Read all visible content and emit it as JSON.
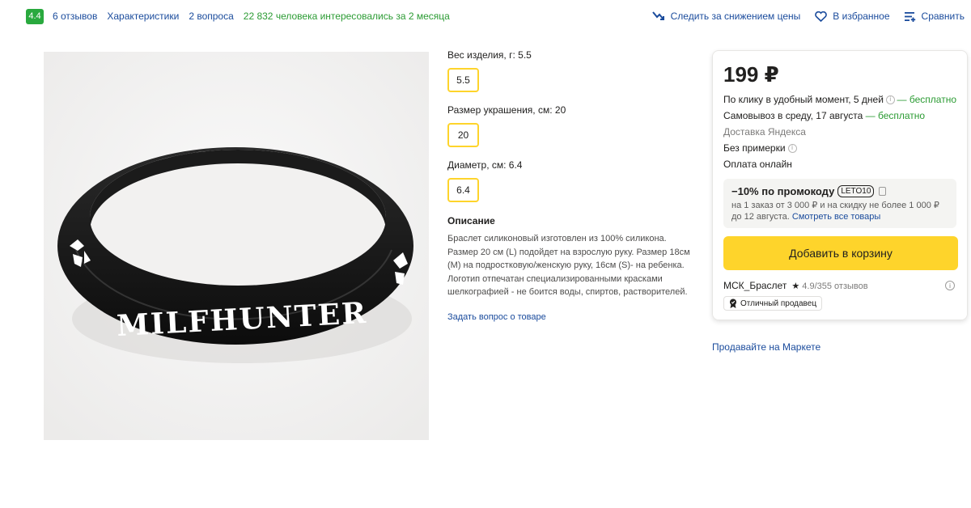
{
  "top_bar": {
    "rating": "4.4",
    "reviews_link": "6 отзывов",
    "specs_link": "Характеристики",
    "questions_link": "2 вопроса",
    "interest_text": "22 832 человека интересовались за 2 месяца",
    "actions": {
      "price_watch": "Следить за снижением цены",
      "favorite": "В избранное",
      "compare": "Сравнить"
    }
  },
  "product_image": {
    "bracelet_text": "MILFHUNTER",
    "colors": {
      "band": "#111111",
      "print": "#ffffff"
    }
  },
  "specs": [
    {
      "label": "Вес изделия, г:",
      "value": "5.5",
      "chip": "5.5"
    },
    {
      "label": "Размер украшения, см:",
      "value": "20",
      "chip": "20"
    },
    {
      "label": "Диаметр, см:",
      "value": "6.4",
      "chip": "6.4"
    }
  ],
  "description": {
    "title": "Описание",
    "text": "Браслет силиконовый изготовлен из 100% силикона. Размер 20 см (L) подойдет на взрослую руку. Размер 18см (М) на подростковую/женскую руку, 16см (S)- на ребенка. Логотип отпечатан специализированными красками шелкографией - не боится воды, спиртов, растворителей.",
    "ask_link": "Задать вопрос о товаре"
  },
  "offer": {
    "price": "199 ₽",
    "delivery_click": "По клику в удобный момент, 5 дней",
    "delivery_click_price": "— бесплатно",
    "pickup": "Самовывоз в среду, 17 августа",
    "pickup_price": "— бесплатно",
    "delivery_service": "Доставка Яндекса",
    "no_fitting": "Без примерки",
    "payment": "Оплата онлайн",
    "promo": {
      "title": "−10% по промокоду",
      "code": "LETO10",
      "text": "на 1 заказ от 3 000 ₽ и на скидку не более 1 000 ₽ до 12 августа.",
      "link": "Смотреть все товары"
    },
    "add_to_cart": "Добавить в корзину",
    "seller": {
      "name": "МСК_Браслет",
      "star": "★",
      "rating": "4.9",
      "reviews": "/355 отзывов",
      "badge": "Отличный продавец"
    }
  },
  "sell_link": "Продавайте на Маркете",
  "colors": {
    "accent_yellow": "#fed42b",
    "link_blue": "#1a4b9c",
    "green": "#2b9b33",
    "rating_green": "#29a93e"
  }
}
